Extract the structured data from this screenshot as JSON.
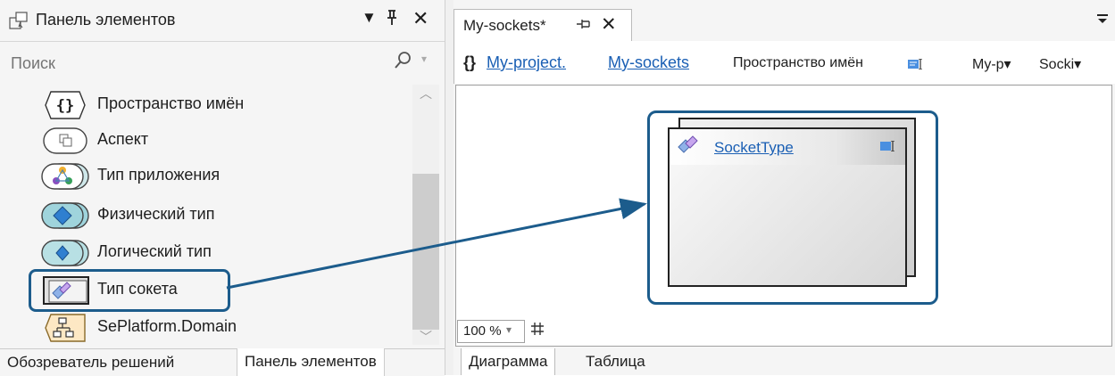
{
  "toolbox": {
    "title": "Панель элементов",
    "menu_glyph": "▼",
    "pin_glyph": "ᛧ",
    "close_glyph": "✕",
    "search_placeholder": "Поиск",
    "items": [
      {
        "label": "Пространство имён",
        "icon": "namespace-icon"
      },
      {
        "label": "Аспект",
        "icon": "aspect-icon"
      },
      {
        "label": "Тип приложения",
        "icon": "application-type-icon"
      },
      {
        "label": "Физический тип",
        "icon": "physical-type-icon"
      },
      {
        "label": "Логический тип",
        "icon": "logical-type-icon"
      },
      {
        "label": "Тип сокета",
        "icon": "socket-type-icon",
        "highlighted": true
      },
      {
        "label": "SePlatform.Domain",
        "icon": "domain-icon"
      }
    ],
    "tabs": [
      "Обозреватель решений",
      "Панель элементов"
    ],
    "active_tab": "Панель элементов"
  },
  "editor": {
    "doc_tab": "My-sockets*",
    "crumb_brace": "{}",
    "crumb_project": "My-project.",
    "crumb_sockets": "My-sockets",
    "crumb_kind": "Пространство имён",
    "dropdown1": "My-p▾",
    "dropdown2": "Socki▾",
    "overflow_glyph": "▾",
    "diagram": {
      "element_name": "SocketType"
    },
    "zoom": "100 %",
    "tabs": [
      "Диаграмма",
      "Таблица"
    ],
    "active_tab": "Диаграмма"
  },
  "colors": {
    "accent": "#1a5fb4",
    "callout_border": "#1c5c8c",
    "panel_bg": "#f5f5f5"
  }
}
